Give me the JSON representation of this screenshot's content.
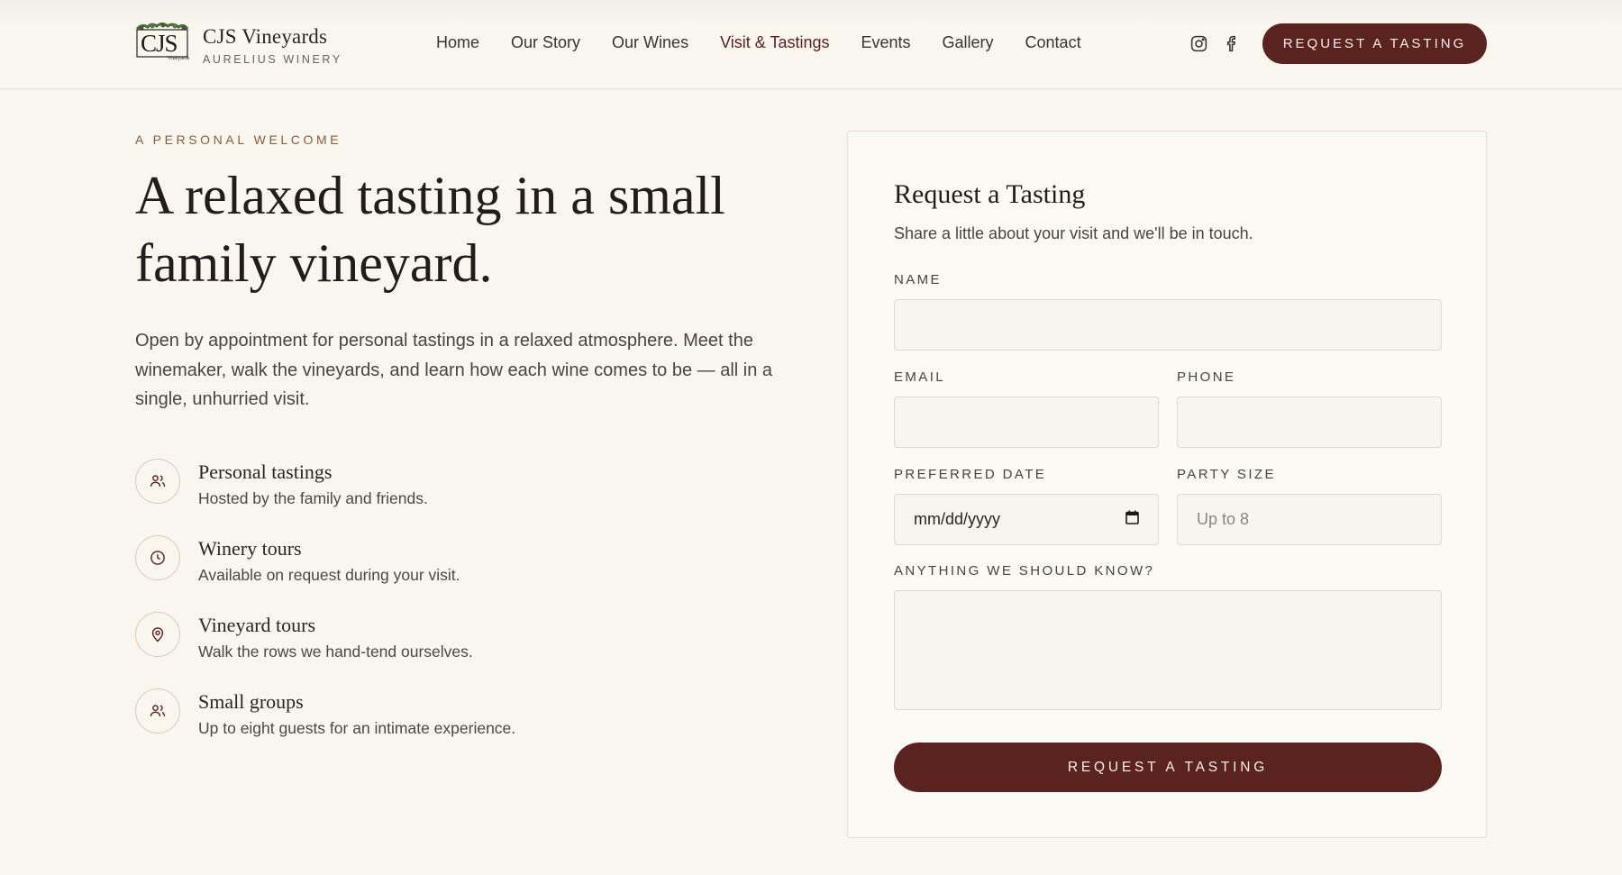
{
  "header": {
    "logo_text": "CJS",
    "logo_caption": "Vineyards",
    "brand_name": "CJS Vineyards",
    "brand_sub": "AURELIUS WINERY",
    "nav": [
      {
        "label": "Home",
        "active": false
      },
      {
        "label": "Our Story",
        "active": false
      },
      {
        "label": "Our Wines",
        "active": false
      },
      {
        "label": "Visit & Tastings",
        "active": true
      },
      {
        "label": "Events",
        "active": false
      },
      {
        "label": "Gallery",
        "active": false
      },
      {
        "label": "Contact",
        "active": false
      }
    ],
    "social": [
      "instagram-icon",
      "facebook-icon"
    ],
    "cta_label": "REQUEST A TASTING"
  },
  "hero": {
    "eyebrow": "A PERSONAL WELCOME",
    "headline_line1": "A relaxed tasting in a small",
    "headline_line2": "family vineyard.",
    "lede": "Open by appointment for personal tastings in a relaxed atmosphere. Meet the winemaker, walk the vineyards, and learn how each wine comes to be — all in a single, unhurried visit."
  },
  "features": [
    {
      "icon": "users-icon",
      "title": "Personal tastings",
      "desc": "Hosted by the family and friends."
    },
    {
      "icon": "clock-icon",
      "title": "Winery tours",
      "desc": "Available on request during your visit."
    },
    {
      "icon": "map-pin-icon",
      "title": "Vineyard tours",
      "desc": "Walk the rows we hand-tend ourselves."
    },
    {
      "icon": "users-icon",
      "title": "Small groups",
      "desc": "Up to eight guests for an intimate experience."
    }
  ],
  "form": {
    "title": "Request a Tasting",
    "subtitle": "Share a little about your visit and we'll be in touch.",
    "name_label": "NAME",
    "name_value": "",
    "email_label": "EMAIL",
    "email_value": "",
    "phone_label": "PHONE",
    "phone_value": "",
    "date_label": "PREFERRED DATE",
    "date_value": "mm/dd/yyyy",
    "party_label": "PARTY SIZE",
    "party_placeholder": "Up to 8",
    "notes_label": "ANYTHING WE SHOULD KNOW?",
    "notes_value": "",
    "submit_label": "REQUEST A TASTING"
  },
  "colors": {
    "background": "#f9f6ef",
    "accent": "#5a2320",
    "nav_active": "#5a1f1e",
    "eyebrow": "#8a5a3c"
  }
}
